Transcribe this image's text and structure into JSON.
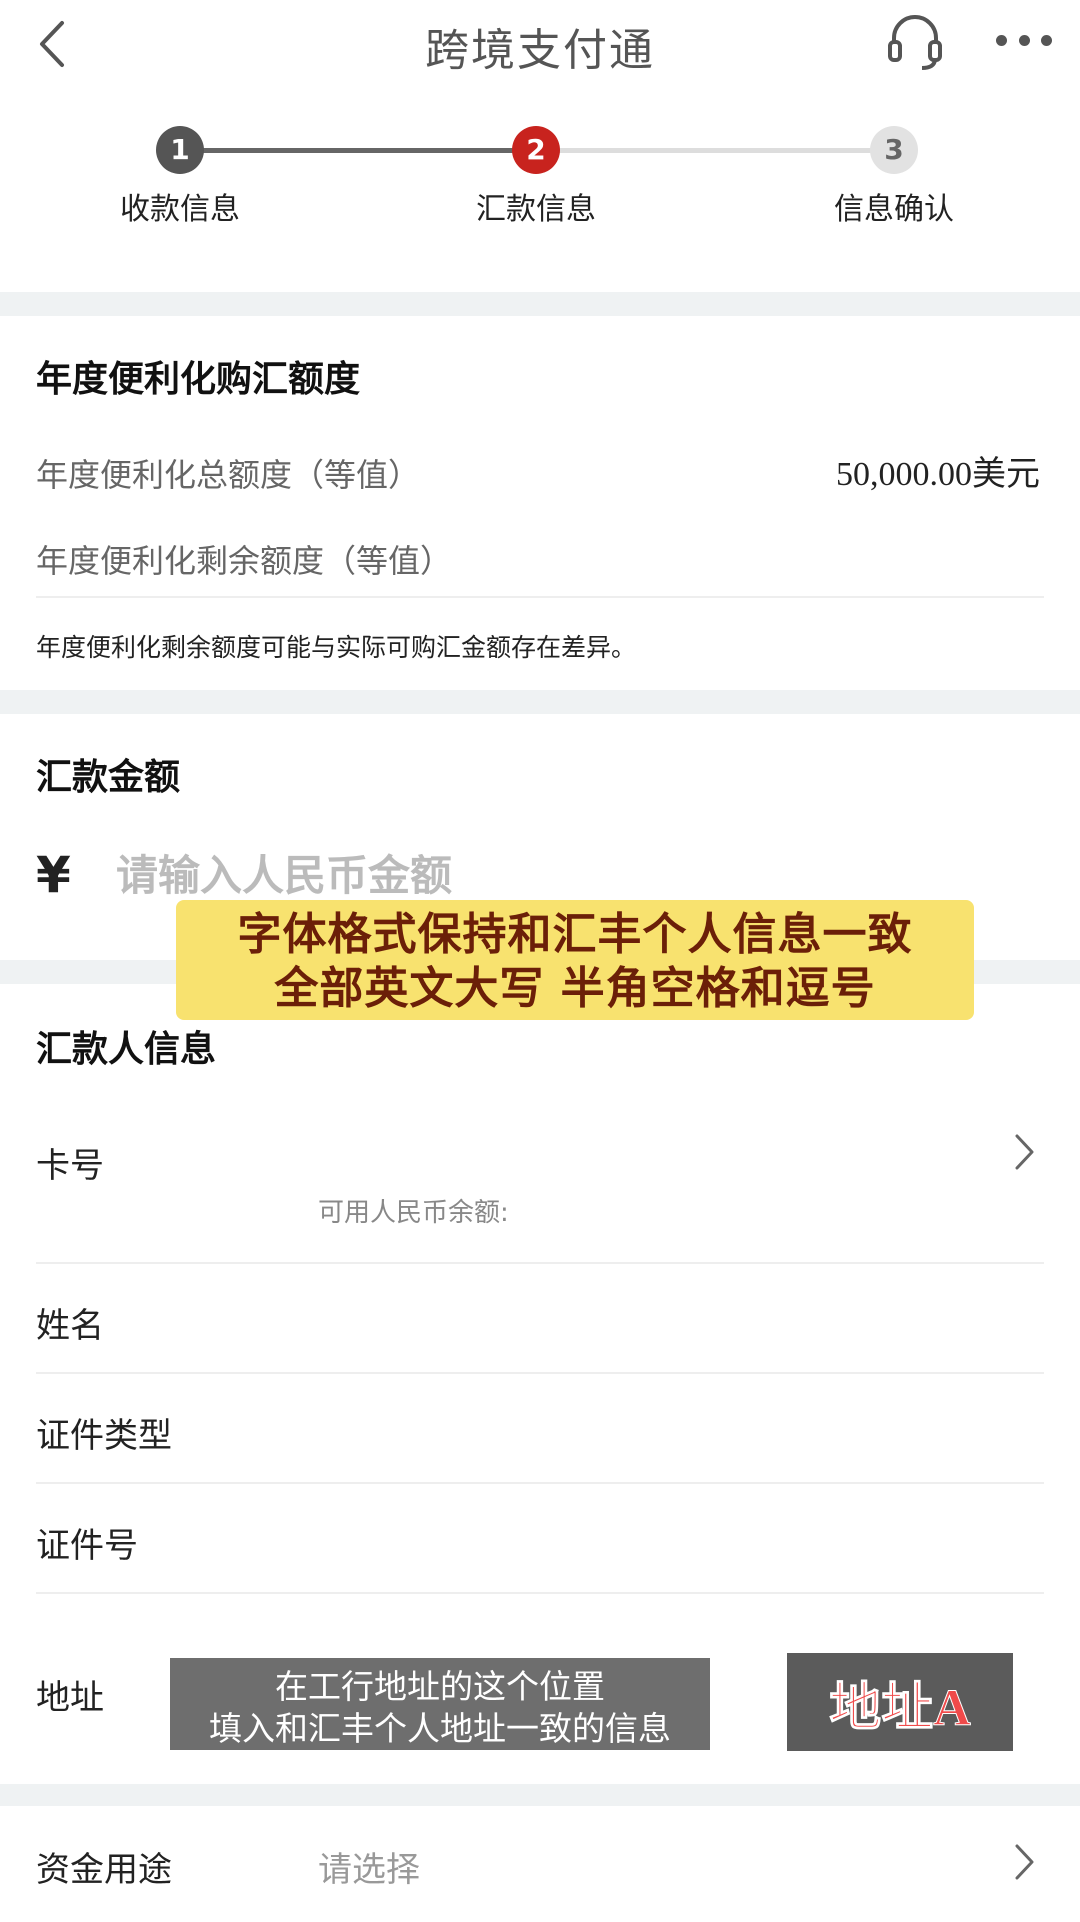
{
  "header": {
    "title": "跨境支付通"
  },
  "steps": [
    {
      "number": "1",
      "label": "收款信息"
    },
    {
      "number": "2",
      "label": "汇款信息"
    },
    {
      "number": "3",
      "label": "信息确认"
    }
  ],
  "quota": {
    "title": "年度便利化购汇额度",
    "total_label": "年度便利化总额度（等值）",
    "total_value": "50,000.00美元",
    "remaining_label": "年度便利化剩余额度（等值）",
    "note": "年度便利化剩余额度可能与实际可购汇金额存在差异。"
  },
  "amount": {
    "title": "汇款金额",
    "currency_symbol": "¥",
    "placeholder": "请输入人民币金额"
  },
  "remitter": {
    "title": "汇款人信息",
    "card_label": "卡号",
    "balance_label": "可用人民币余额:",
    "name_label": "姓名",
    "id_type_label": "证件类型",
    "id_number_label": "证件号",
    "address_label": "地址"
  },
  "purpose": {
    "label": "资金用途",
    "placeholder": "请选择"
  },
  "overlays": {
    "yellow_line1": "字体格式保持和汇丰个人信息一致",
    "yellow_line2": "全部英文大写 半角空格和逗号",
    "gray_line1": "在工行地址的这个位置",
    "gray_line2": "填入和汇丰个人地址一致的信息",
    "badge": "地址A"
  }
}
